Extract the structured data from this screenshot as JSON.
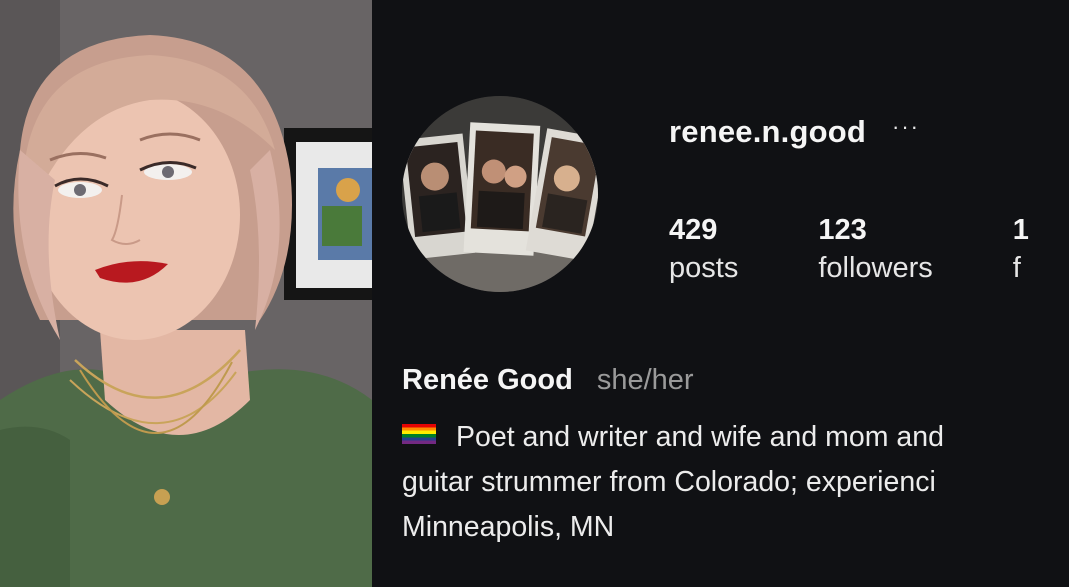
{
  "profile": {
    "username": "renee.n.good",
    "more_icon": "more-horizontal-icon",
    "more_glyph": "···",
    "stats": [
      {
        "value": "429",
        "label": "posts"
      },
      {
        "value": "123",
        "label": "followers"
      },
      {
        "value": "1",
        "label": "f"
      }
    ],
    "display_name": "Renée Good",
    "pronouns": "she/her",
    "flag_icon": "rainbow-flag-icon",
    "bio_lines": [
      "Poet and writer and wife and mom and",
      "guitar strummer from Colorado; experienci",
      "Minneapolis, MN"
    ]
  },
  "colors": {
    "panel_background": "#101114",
    "text_primary": "#f5f5f5",
    "text_secondary": "#9a9a9a"
  }
}
